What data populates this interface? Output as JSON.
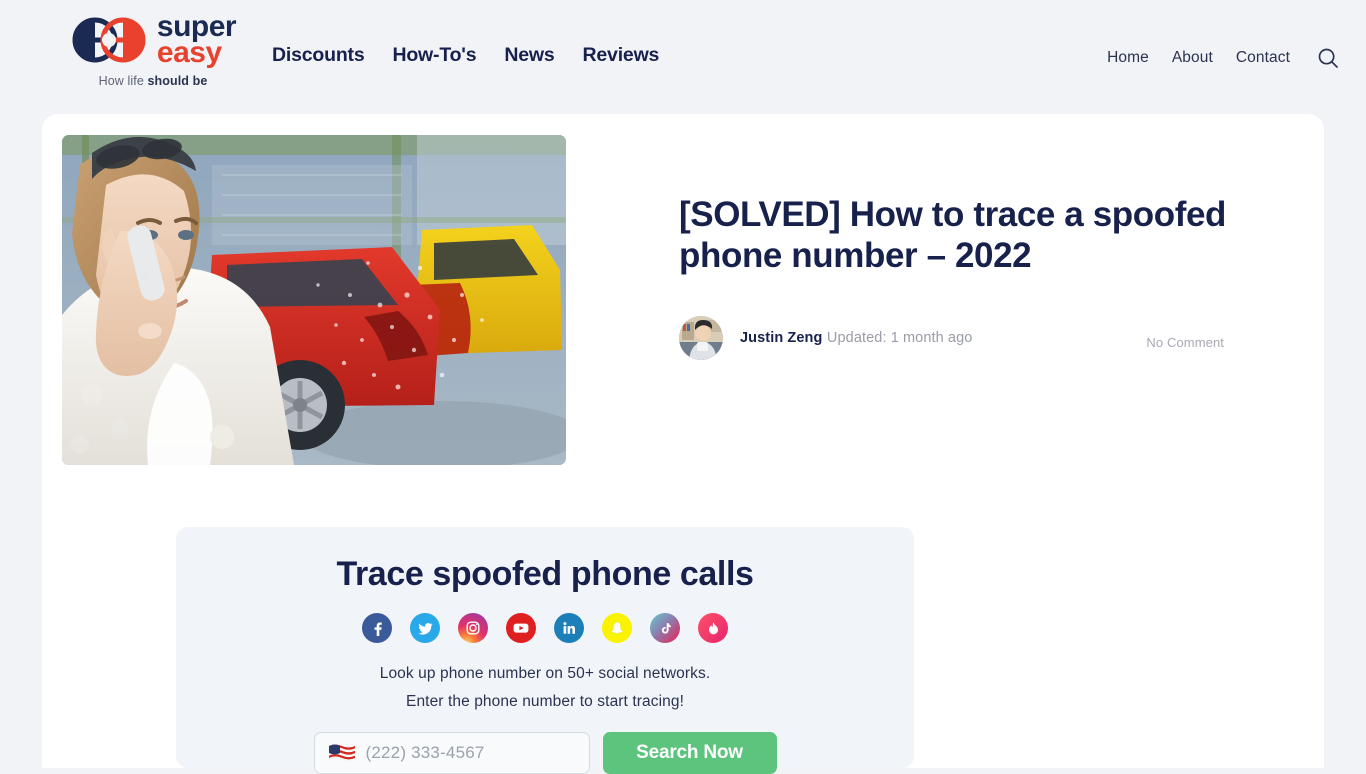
{
  "brand": {
    "name_line1": "super",
    "name_line2": "easy",
    "tagline_prefix": "How life ",
    "tagline_bold": "should be",
    "logo_navy": "#1b2a52",
    "logo_red": "#e8422f"
  },
  "nav": {
    "primary": [
      {
        "label": "Discounts"
      },
      {
        "label": "How-To's"
      },
      {
        "label": "News"
      },
      {
        "label": "Reviews"
      }
    ],
    "utility": [
      {
        "label": "Home"
      },
      {
        "label": "About"
      },
      {
        "label": "Contact"
      }
    ],
    "search_icon": "search-icon"
  },
  "article": {
    "title": "[SOLVED] How to trace a spoofed phone number – 2022",
    "author": "Justin Zeng",
    "updated": "Updated: 1 month ago",
    "comments": "No Comment",
    "hero_alt": "woman-on-phone-car-crash"
  },
  "widget": {
    "title": "Trace spoofed phone calls",
    "copy_line1": "Look up phone number on 50+ social networks.",
    "copy_line2": "Enter the phone number to start tracing!",
    "socials": [
      {
        "name": "facebook-icon",
        "color": "#3b5a9a"
      },
      {
        "name": "twitter-icon",
        "color": "#29a9ea"
      },
      {
        "name": "instagram-icon",
        "color": "#d6317f"
      },
      {
        "name": "youtube-icon",
        "color": "#e02020"
      },
      {
        "name": "linkedin-icon",
        "color": "#1d7fb8"
      },
      {
        "name": "snapchat-icon",
        "color": "#f9f200"
      },
      {
        "name": "tiktok-icon",
        "color": "#9a6b8e"
      },
      {
        "name": "tinder-icon",
        "color": "#f2455f"
      }
    ],
    "phone_placeholder": "(222) 333-4567",
    "phone_value": "",
    "country_flag": "us-flag-icon",
    "submit_label": "Search Now",
    "submit_color": "#5cc47c"
  }
}
